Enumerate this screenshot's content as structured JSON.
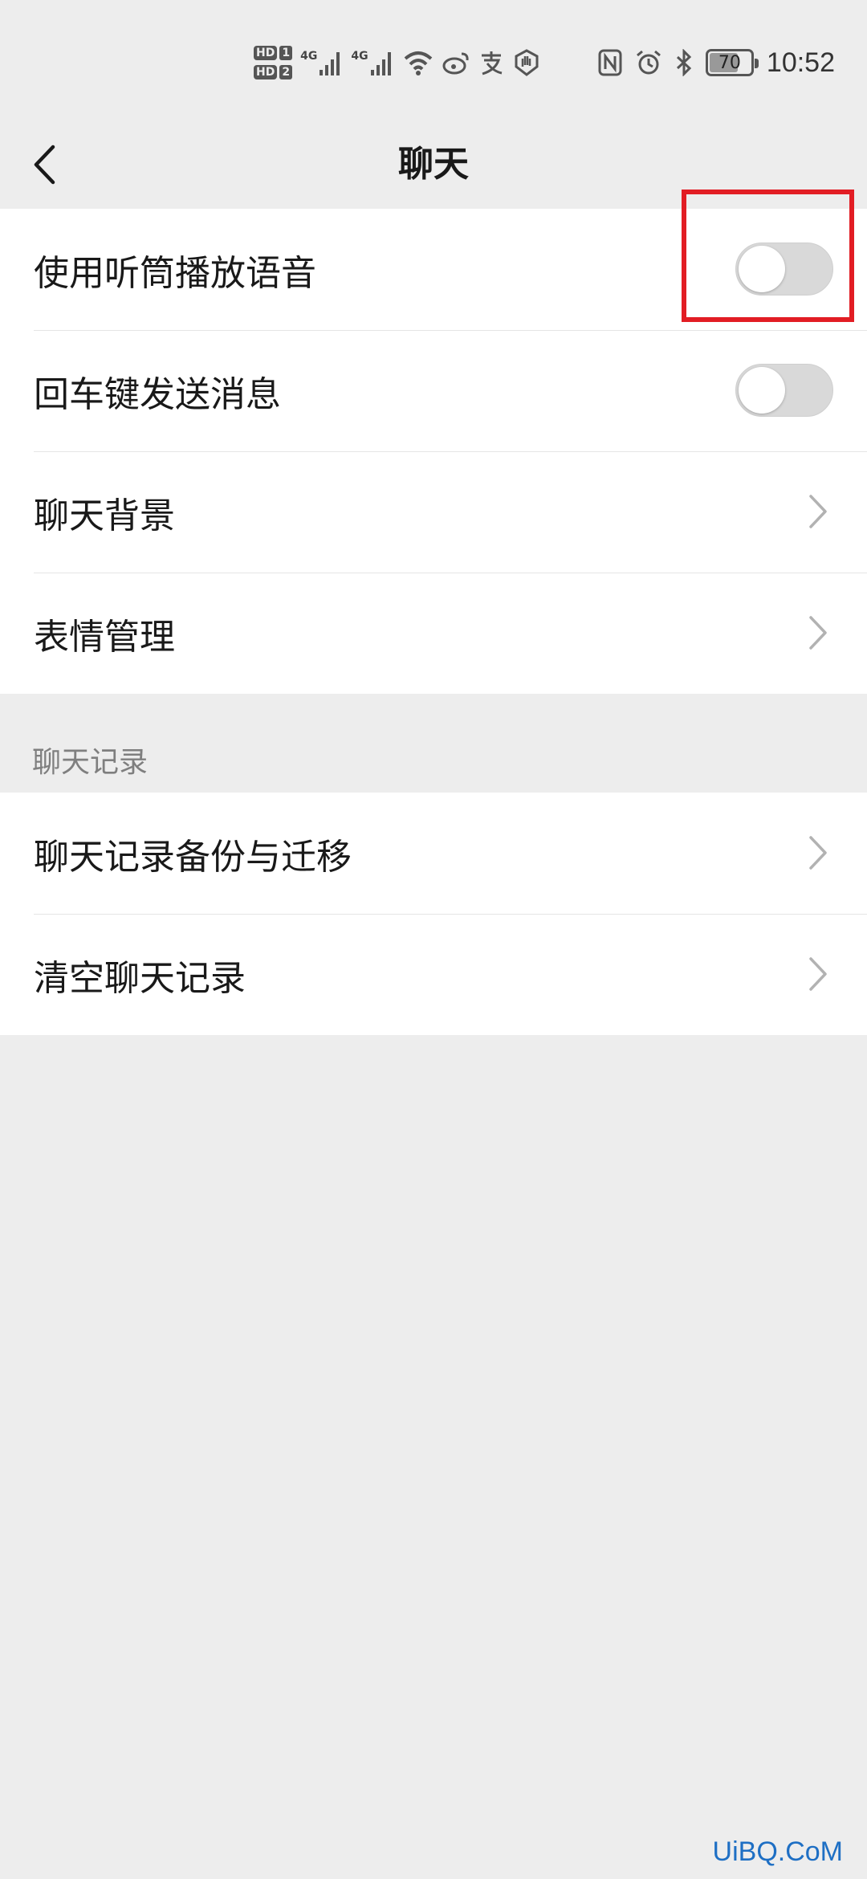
{
  "status_bar": {
    "hd1": "HD",
    "hd1_num": "1",
    "hd2": "HD",
    "hd2_num": "2",
    "net1": "4G",
    "net2": "4G",
    "battery": "70",
    "battery_level": 0.7,
    "time": "10:52"
  },
  "header": {
    "title": "聊天"
  },
  "group1": {
    "items": [
      {
        "label": "使用听筒播放语音",
        "type": "toggle",
        "on": false
      },
      {
        "label": "回车键发送消息",
        "type": "toggle",
        "on": false
      },
      {
        "label": "聊天背景",
        "type": "link"
      },
      {
        "label": "表情管理",
        "type": "link"
      }
    ]
  },
  "section2": {
    "label": "聊天记录",
    "items": [
      {
        "label": "聊天记录备份与迁移",
        "type": "link"
      },
      {
        "label": "清空聊天记录",
        "type": "link"
      }
    ]
  },
  "colors": {
    "background": "#ededed",
    "card": "#ffffff",
    "highlight": "#e21d24",
    "watermark": "#1e6fc4"
  },
  "watermark": "UiBQ.CoM"
}
